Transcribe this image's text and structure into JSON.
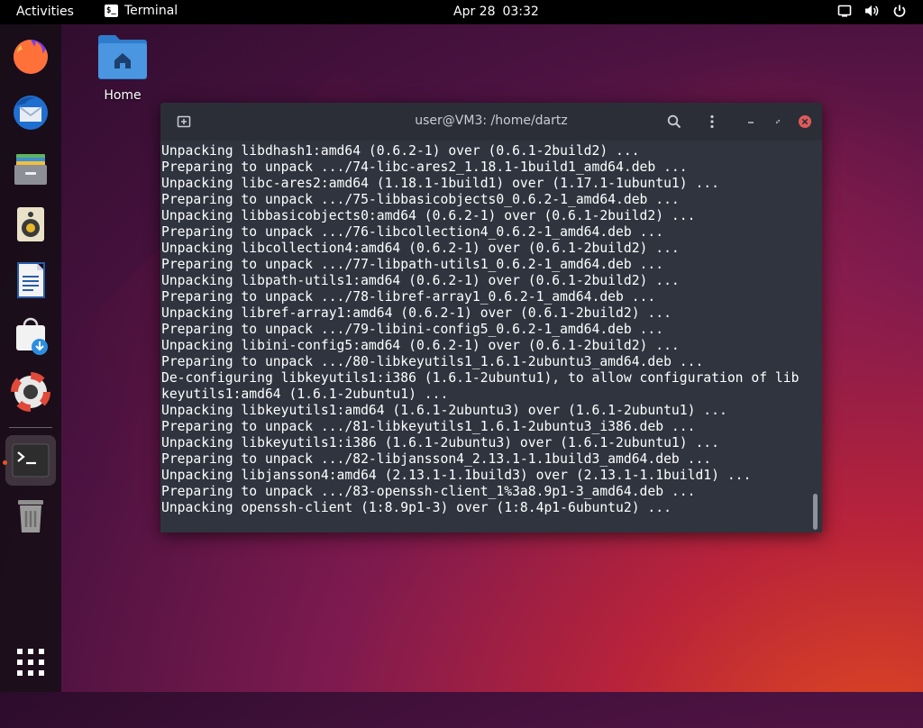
{
  "topbar": {
    "activities": "Activities",
    "app_name": "Terminal",
    "app_glyph": "$_",
    "date": "Apr 28",
    "time": "03:32",
    "tray_icons": [
      "screen-icon",
      "volume-icon",
      "power-icon"
    ]
  },
  "dock": {
    "items": [
      "firefox-icon",
      "thunderbird-icon",
      "files-icon",
      "rhythmbox-icon",
      "writer-icon",
      "software-icon",
      "help-icon",
      "terminal-icon",
      "trash-icon"
    ],
    "running_indicator_color": "#e95420",
    "show_apps_icon": "app-grid-icon"
  },
  "desktop": {
    "home_label": "Home"
  },
  "terminal": {
    "title": "user@VM3: /home/dartz",
    "lines": [
      "Unpacking libdhash1:amd64 (0.6.2-1) over (0.6.1-2build2) ...",
      "Preparing to unpack .../74-libc-ares2_1.18.1-1build1_amd64.deb ...",
      "Unpacking libc-ares2:amd64 (1.18.1-1build1) over (1.17.1-1ubuntu1) ...",
      "Preparing to unpack .../75-libbasicobjects0_0.6.2-1_amd64.deb ...",
      "Unpacking libbasicobjects0:amd64 (0.6.2-1) over (0.6.1-2build2) ...",
      "Preparing to unpack .../76-libcollection4_0.6.2-1_amd64.deb ...",
      "Unpacking libcollection4:amd64 (0.6.2-1) over (0.6.1-2build2) ...",
      "Preparing to unpack .../77-libpath-utils1_0.6.2-1_amd64.deb ...",
      "Unpacking libpath-utils1:amd64 (0.6.2-1) over (0.6.1-2build2) ...",
      "Preparing to unpack .../78-libref-array1_0.6.2-1_amd64.deb ...",
      "Unpacking libref-array1:amd64 (0.6.2-1) over (0.6.1-2build2) ...",
      "Preparing to unpack .../79-libini-config5_0.6.2-1_amd64.deb ...",
      "Unpacking libini-config5:amd64 (0.6.2-1) over (0.6.1-2build2) ...",
      "Preparing to unpack .../80-libkeyutils1_1.6.1-2ubuntu3_amd64.deb ...",
      "De-configuring libkeyutils1:i386 (1.6.1-2ubuntu1), to allow configuration of lib",
      "keyutils1:amd64 (1.6.1-2ubuntu1) ...",
      "Unpacking libkeyutils1:amd64 (1.6.1-2ubuntu3) over (1.6.1-2ubuntu1) ...",
      "Preparing to unpack .../81-libkeyutils1_1.6.1-2ubuntu3_i386.deb ...",
      "Unpacking libkeyutils1:i386 (1.6.1-2ubuntu3) over (1.6.1-2ubuntu1) ...",
      "Preparing to unpack .../82-libjansson4_2.13.1-1.1build3_amd64.deb ...",
      "Unpacking libjansson4:amd64 (2.13.1-1.1build3) over (2.13.1-1.1build1) ...",
      "Preparing to unpack .../83-openssh-client_1%3a8.9p1-3_amd64.deb ...",
      "Unpacking openssh-client (1:8.9p1-3) over (1:8.4p1-6ubuntu2) ..."
    ]
  },
  "colors": {
    "topbar": "#000000",
    "terminal_bg": "#2f343f",
    "titlebar_bg": "#2b2e37",
    "close_button": "#e05a5a",
    "accent": "#e95420"
  }
}
